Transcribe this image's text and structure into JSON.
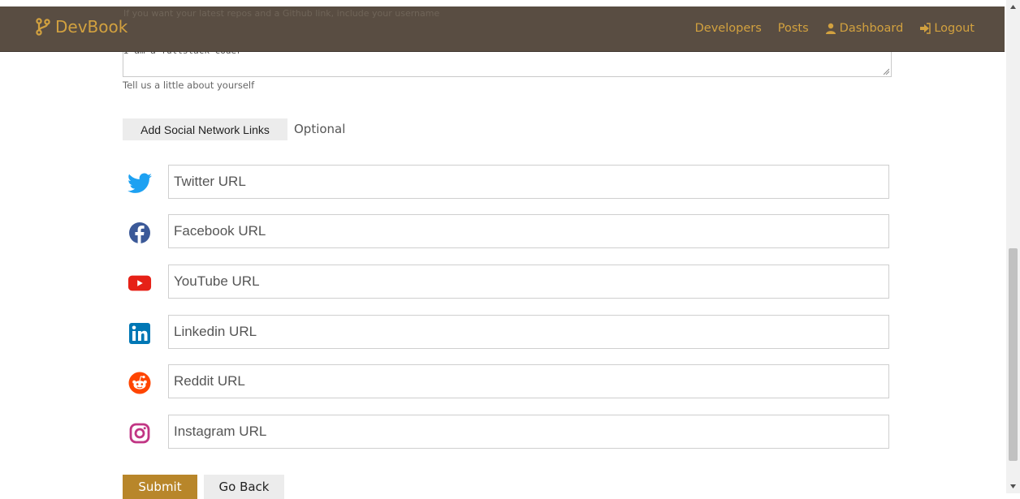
{
  "navbar": {
    "brand": "DevBook",
    "links": [
      {
        "label": "Developers",
        "icon": null
      },
      {
        "label": "Posts",
        "icon": null
      },
      {
        "label": "Dashboard",
        "icon": "user-icon"
      },
      {
        "label": "Logout",
        "icon": "sign-out-icon"
      }
    ],
    "background": "#594d42",
    "accent": "#d2a13f"
  },
  "form": {
    "hidden_hint": "If you want your latest repos and a Github link, include your username",
    "bio_value": "I am a fullstack coder",
    "bio_helper": "Tell us a little about yourself",
    "social_toggle_label": "Add Social Network Links",
    "optional_label": "Optional",
    "social_fields": [
      {
        "network": "twitter",
        "icon": "twitter-icon",
        "placeholder": "Twitter URL",
        "color": "#1da1f2"
      },
      {
        "network": "facebook",
        "icon": "facebook-icon",
        "placeholder": "Facebook URL",
        "color": "#3b5998"
      },
      {
        "network": "youtube",
        "icon": "youtube-icon",
        "placeholder": "YouTube URL",
        "color": "#e62117"
      },
      {
        "network": "linkedin",
        "icon": "linkedin-icon",
        "placeholder": "Linkedin URL",
        "color": "#0077b5"
      },
      {
        "network": "reddit",
        "icon": "reddit-icon",
        "placeholder": "Reddit URL",
        "color": "#ff4500"
      },
      {
        "network": "instagram",
        "icon": "instagram-icon",
        "placeholder": "Instagram URL",
        "color": "#c13584"
      }
    ],
    "submit_label": "Submit",
    "back_label": "Go Back",
    "submit_color": "#b8862a"
  }
}
